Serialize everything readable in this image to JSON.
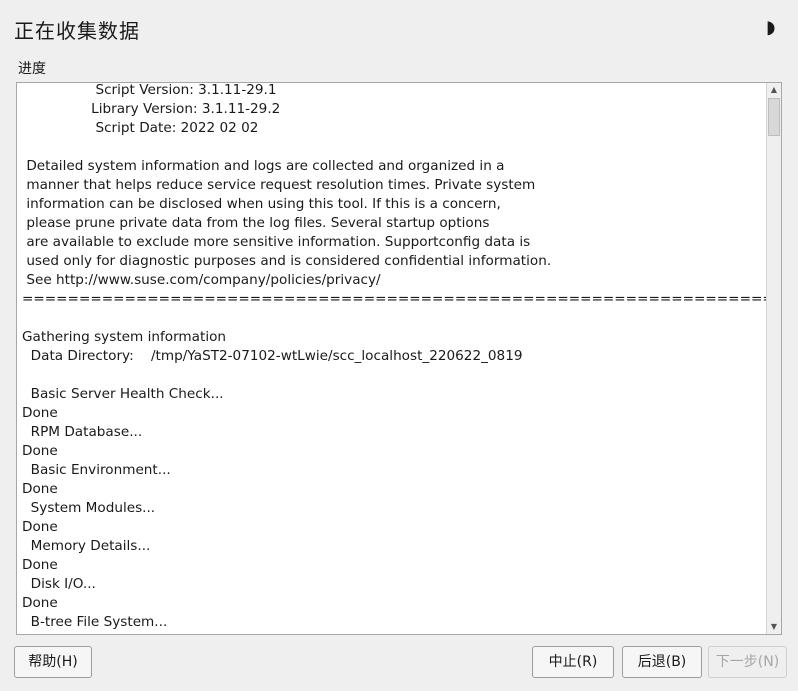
{
  "window": {
    "title": "正在收集数据",
    "status_icon": "moon-icon"
  },
  "progress": {
    "label": "进度",
    "log": "                 Script Version: 3.1.11-29.1\n                Library Version: 3.1.11-29.2\n                 Script Date: 2022 02 02\n\n Detailed system information and logs are collected and organized in a\n manner that helps reduce service request resolution times. Private system\n information can be disclosed when using this tool. If this is a concern,\n please prune private data from the log files. Several startup options\n are available to exclude more sensitive information. Supportconfig data is\n used only for diagnostic purposes and is considered confidential information.\n See http://www.suse.com/company/policies/privacy/\n============================================================================\n\nGathering system information\n  Data Directory:    /tmp/YaST2-07102-wtLwie/scc_localhost_220622_0819\n\n  Basic Server Health Check...\nDone\n  RPM Database...\nDone\n  Basic Environment...\nDone\n  System Modules...\nDone\n  Memory Details...\nDone\n  Disk I/O...\nDone\n  B-tree File System..."
  },
  "buttons": {
    "help": "帮助(H)",
    "abort": "中止(R)",
    "back": "后退(B)",
    "next": "下一步(N)"
  },
  "colors": {
    "window_bg": "#efefef",
    "log_bg": "#ffffff",
    "border": "#a7a7a7",
    "disabled_text": "#a6a6a6"
  }
}
